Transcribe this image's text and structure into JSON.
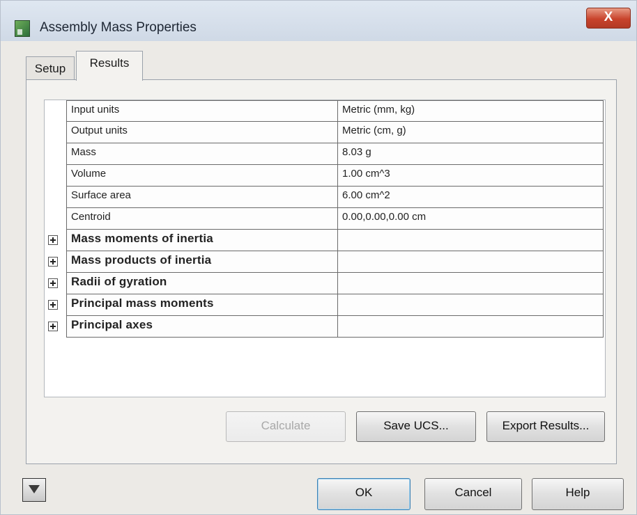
{
  "window": {
    "title": "Assembly Mass Properties",
    "close_label": "X",
    "app_icon": "assembly-app-icon"
  },
  "tabs": [
    {
      "label": "Setup",
      "active": false
    },
    {
      "label": "Results",
      "active": true
    }
  ],
  "results": {
    "rows": [
      {
        "name": "Input units",
        "value": "Metric (mm, kg)",
        "expandable": false
      },
      {
        "name": "Output units",
        "value": "Metric (cm, g)",
        "expandable": false
      },
      {
        "name": "Mass",
        "value": "8.03 g",
        "expandable": false
      },
      {
        "name": "Volume",
        "value": "1.00 cm^3",
        "expandable": false
      },
      {
        "name": "Surface area",
        "value": "6.00 cm^2",
        "expandable": false
      },
      {
        "name": "Centroid",
        "value": "0.00,0.00,0.00 cm",
        "expandable": false
      },
      {
        "name": "Mass moments of inertia",
        "value": "",
        "expandable": true
      },
      {
        "name": "Mass products of inertia",
        "value": "",
        "expandable": true
      },
      {
        "name": "Radii of gyration",
        "value": "",
        "expandable": true
      },
      {
        "name": "Principal mass moments",
        "value": "",
        "expandable": true
      },
      {
        "name": "Principal axes",
        "value": "",
        "expandable": true
      }
    ]
  },
  "actions": {
    "calculate_label": "Calculate",
    "save_ucs_label": "Save UCS...",
    "export_label": "Export Results..."
  },
  "dialog_buttons": {
    "ok_label": "OK",
    "cancel_label": "Cancel",
    "help_label": "Help"
  },
  "colors": {
    "title_bar": "#cfd9e6",
    "close_button": "#c8432c",
    "default_button_border": "#3c7fb1"
  }
}
